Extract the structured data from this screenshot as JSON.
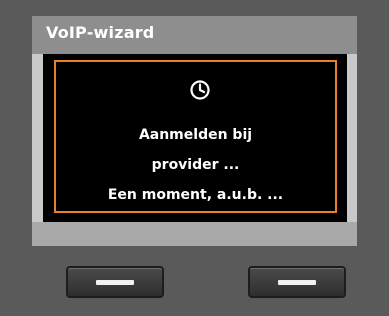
{
  "screen": {
    "title": "VoIP-wizard",
    "icon": "clock-icon",
    "message_lines": [
      "Aanmelden bij",
      "provider ...",
      "Een moment, a.u.b. ..."
    ]
  },
  "colors": {
    "title_bar": "#8e8e8e",
    "frame_accent": "#e8802a",
    "content_bg": "#000000"
  },
  "keys": {
    "left_icon": "dash-icon",
    "right_icon": "dash-icon"
  }
}
